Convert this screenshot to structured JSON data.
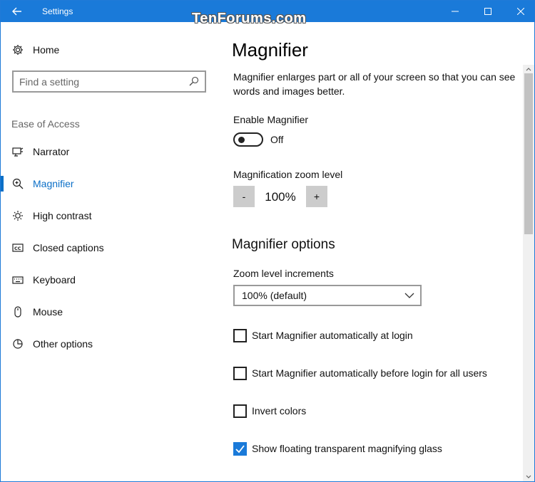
{
  "window": {
    "title": "Settings",
    "watermark": "TenForums.com",
    "accent_color": "#1a7ad9",
    "controls": [
      "minimize-icon",
      "maximize-icon",
      "close-icon"
    ]
  },
  "sidebar": {
    "home_label": "Home",
    "search_placeholder": "Find a setting",
    "section_label": "Ease of Access",
    "items": [
      {
        "label": "Narrator",
        "icon": "narrator-icon",
        "active": false
      },
      {
        "label": "Magnifier",
        "icon": "magnifier-icon",
        "active": true
      },
      {
        "label": "High contrast",
        "icon": "brightness-icon",
        "active": false
      },
      {
        "label": "Closed captions",
        "icon": "cc-icon",
        "active": false
      },
      {
        "label": "Keyboard",
        "icon": "keyboard-icon",
        "active": false
      },
      {
        "label": "Mouse",
        "icon": "mouse-icon",
        "active": false
      },
      {
        "label": "Other options",
        "icon": "other-options-icon",
        "active": false
      }
    ]
  },
  "main": {
    "title": "Magnifier",
    "description": "Magnifier enlarges part or all of your screen so that you can see words and images better.",
    "enable_label": "Enable Magnifier",
    "enable_state": "Off",
    "enable_on": false,
    "zoom_label": "Magnification zoom level",
    "zoom_minus": "-",
    "zoom_plus": "+",
    "zoom_value": "100%",
    "options_title": "Magnifier options",
    "increments_label": "Zoom level increments",
    "increments_value": "100% (default)",
    "checkboxes": [
      {
        "label": "Start Magnifier automatically at login",
        "checked": false
      },
      {
        "label": "Start Magnifier automatically before login for all users",
        "checked": false
      },
      {
        "label": "Invert colors",
        "checked": false
      },
      {
        "label": "Show floating transparent magnifying glass",
        "checked": true
      }
    ]
  }
}
